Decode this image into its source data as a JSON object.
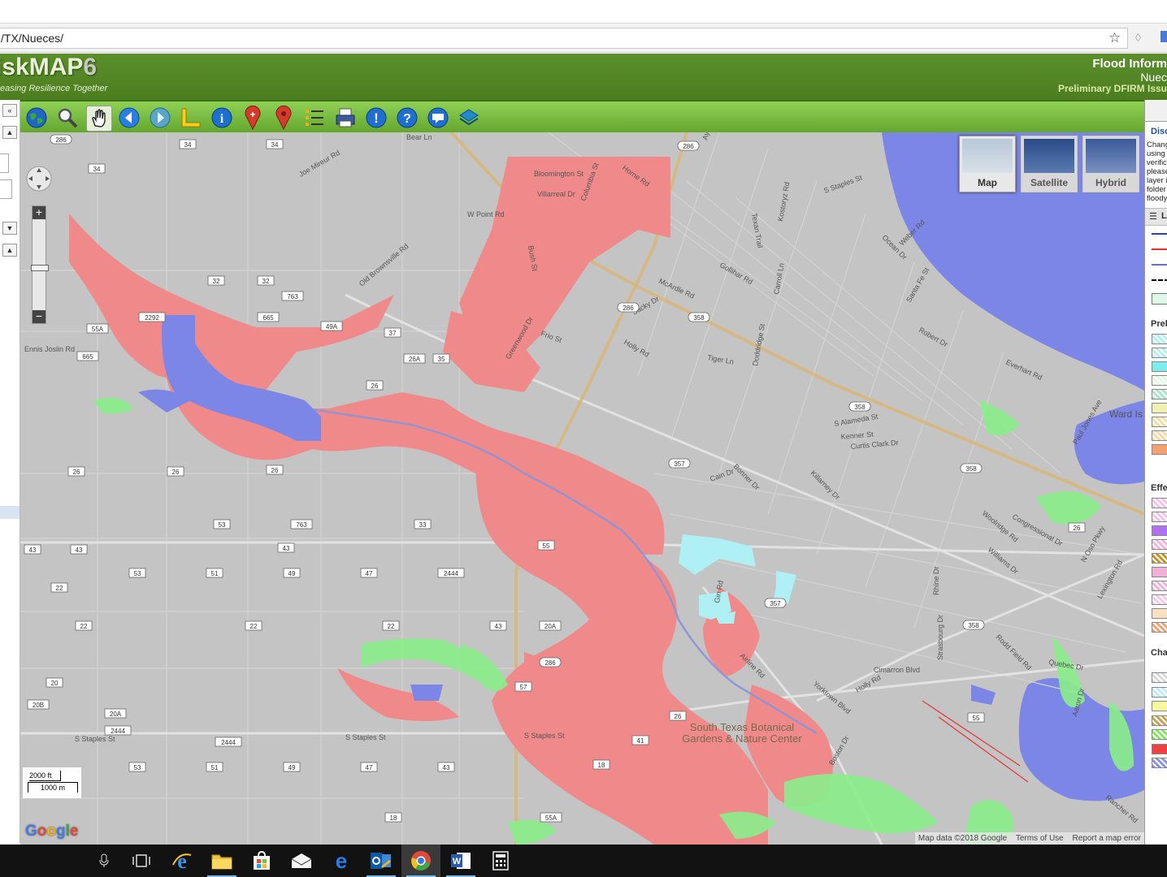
{
  "browser": {
    "url": "/TX/Nueces/"
  },
  "site": {
    "logo_main": "iskMAP",
    "logo_num": "6",
    "tagline": "easing Resilience Together",
    "header_title": "Flood Inform",
    "header_county": "Nuec",
    "header_status": "Preliminary DFIRM Issu"
  },
  "toolbar": {
    "tools": [
      "globe-icon",
      "zoom-icon",
      "pan-hand-icon",
      "back-arrow-icon",
      "forward-arrow-icon",
      "measure-ruler-icon",
      "info-icon",
      "add-marker-icon",
      "marker-icon",
      "legend-list-icon",
      "print-icon",
      "alert-icon",
      "help-icon",
      "feedback-icon",
      "layers-icon"
    ]
  },
  "map": {
    "types": [
      "Map",
      "Satellite",
      "Hybrid"
    ],
    "active_type": "Map",
    "scale_ft": "2000 ft",
    "scale_m": "1000 m",
    "attribution": "Map data ©2018 Google",
    "terms": "Terms of Use",
    "report": "Report a map error",
    "google": "Google",
    "colors": {
      "water": "#7b86e6",
      "flood_zone": "#f08a8a",
      "change_green": "#8aee8a",
      "change_cyan": "#aef0f4",
      "road": "#d8d8d8",
      "land": "#c4c4c4"
    },
    "places": {
      "nature_center_line1": "South Texas Botanical",
      "nature_center_line2": "Gardens & Nature Center",
      "ward_island": "Ward Is"
    },
    "streets": [
      "Bear Ln",
      "Joe Mireur Rd",
      "W Point Rd",
      "Bloomington St",
      "Villarreal Dr",
      "Horne Rd",
      "Columbia St",
      "Bush St",
      "Old Brownsville Rd",
      "Greenwood Dr",
      "Frio St",
      "Ayers St",
      "Sacky Dr",
      "Holly Rd",
      "Tiger Ln",
      "McArdle Rd",
      "Gollihar Rd",
      "Carroll Ln",
      "Kostoryz Rd",
      "Texan Trail",
      "S Staples St",
      "Doddridge St",
      "Weber Rd",
      "Ocean Dr",
      "Santa Fe St",
      "Robert Dr",
      "Everhart Rd",
      "S Alameda St",
      "Kenner St",
      "Curtis Clark Dr",
      "Bonner Dr",
      "Cain Dr",
      "Killarney Dr",
      "Congressional Dr",
      "Woolridge Rd",
      "Williams Dr",
      "Rhine Dr",
      "Holly Rd",
      "Airline Rd",
      "Yorktown Blvd",
      "Boston Dr",
      "Strasbourg Dr",
      "Cimarron Blvd",
      "Rodd Field Rd",
      "Quebec Dr",
      "N Oso Pkwy",
      "Lexington Rd",
      "Paul Jones Ave",
      "Ennis Joslin Rd",
      "Gin Rd",
      "Aaron Dr",
      "Rancher Rd",
      "Ramfield Rd"
    ],
    "street_s_staples": "S Staples St",
    "route_shields": [
      "34",
      "34",
      "34",
      "286",
      "32",
      "32",
      "763",
      "2292",
      "665",
      "55A",
      "49A",
      "37",
      "665",
      "26A",
      "35",
      "26",
      "286",
      "358",
      "358",
      "358",
      "26",
      "26",
      "26",
      "357",
      "53",
      "763",
      "33",
      "43",
      "43",
      "43",
      "55",
      "53",
      "51",
      "49",
      "47",
      "2444",
      "22",
      "22",
      "22",
      "22",
      "43",
      "20A",
      "286",
      "57",
      "20",
      "20B",
      "20A",
      "2444",
      "2444",
      "41",
      "26",
      "357",
      "358",
      "26",
      "55",
      "53",
      "51",
      "49",
      "47",
      "43",
      "18",
      "18",
      "55A",
      "286"
    ]
  },
  "right_panel": {
    "disclaimer_title": "Disc",
    "disclaimer_lines": [
      "Chang",
      "using",
      "verific",
      "please",
      "layer i",
      "folder",
      "floody"
    ],
    "legend_tab": "L",
    "section_prelim": "Preli",
    "section_effective": "Effec",
    "section_changes": "Cha",
    "line_swatches": [
      "#1e3fd0",
      "#e43030",
      "#6a6ae6",
      "#000000"
    ],
    "prelim_swatches": [
      "#aef0f4",
      "#aef0f4",
      "#7eecec",
      "#e0f8e0",
      "#a6e6c8",
      "#f0f0b0",
      "#f0e0a0",
      "#f8d8a0",
      "#f4a070"
    ],
    "effective_swatches": [
      "#f8c0e8",
      "#f8c0e8",
      "#b070f0",
      "#f8b0e0",
      "#c8901c",
      "#f0b0d8",
      "#f0b0d8",
      "#f8c8e8",
      "#f8e0c0",
      "#f4a070"
    ],
    "change_swatches": [
      "#d8d8d8",
      "#b8eef4",
      "#f8f8a0",
      "#c8a050",
      "#80e860",
      "#f04040",
      "#8890e8"
    ]
  },
  "taskbar": {
    "apps": [
      "microphone-icon",
      "task-view-icon",
      "ie-icon",
      "file-explorer-icon",
      "store-icon",
      "mail-icon",
      "edge-icon",
      "outlook-icon",
      "chrome-icon",
      "word-icon",
      "calculator-icon"
    ]
  }
}
